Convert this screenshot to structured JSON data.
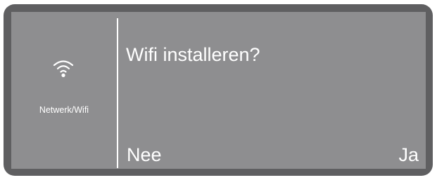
{
  "sidebar": {
    "icon": "wifi-icon",
    "label": "Netwerk/Wifi"
  },
  "main": {
    "prompt": "Wifi installeren?"
  },
  "actions": {
    "no_label": "Nee",
    "yes_label": "Ja"
  },
  "colors": {
    "frame": "#5f5f61",
    "screen": "#8e8e90",
    "text": "#ffffff"
  }
}
